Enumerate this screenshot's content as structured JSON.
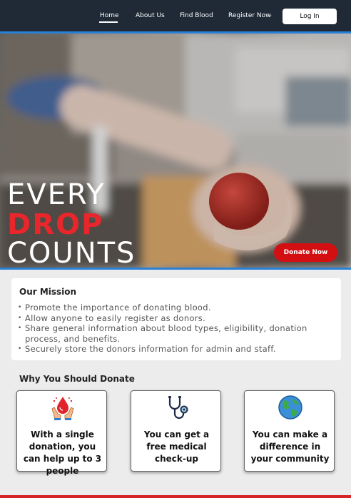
{
  "nav": {
    "items": [
      {
        "label": "Home"
      },
      {
        "label": "About Us"
      },
      {
        "label": "Find Blood"
      },
      {
        "label": "Register Now"
      }
    ],
    "login_label": "Log In"
  },
  "hero": {
    "line1": "EVERY",
    "line2": "DROP",
    "line3": "COUNTS",
    "donate_label": "Donate  Now"
  },
  "mission": {
    "title": "Our Mission",
    "items": [
      "Promote the importance of donating blood.",
      "Allow anyone to easily register as donors.",
      "Share general information about blood types, eligibility, donation process, and benefits.",
      "Securely store the donors information for admin and staff."
    ]
  },
  "why": {
    "title": "Why You Should Donate",
    "cards": [
      {
        "text": "With a single donation, you can help up to 3 people",
        "icon": "blood-drop-hands-icon"
      },
      {
        "text": "You can get a free medical check-up",
        "icon": "stethoscope-icon"
      },
      {
        "text": "You can make a difference in your community",
        "icon": "globe-icon"
      }
    ]
  },
  "colors": {
    "nav_bg": "#1f2a36",
    "accent_blue": "#2a7fd6",
    "brand_red": "#d40f12"
  }
}
